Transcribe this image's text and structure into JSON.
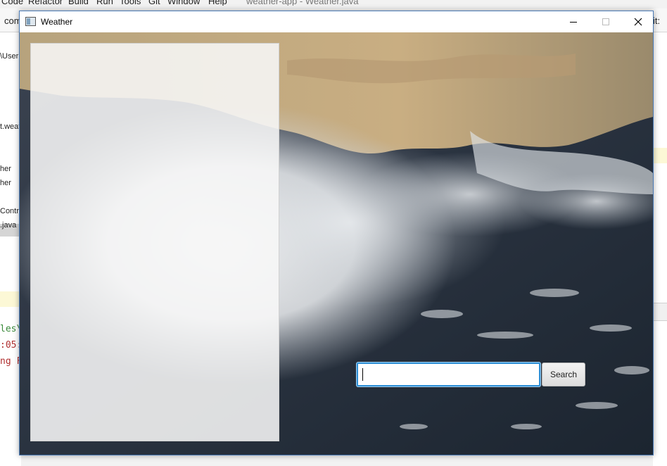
{
  "ide": {
    "menus": [
      "Code",
      "Refactor",
      "Build",
      "Run",
      "Tools",
      "Git",
      "Window",
      "Help"
    ],
    "title": "weather-app - Weather.java",
    "toolbar_left": "com",
    "toolbar_right": "it:",
    "project_rows": [
      "\\User",
      "t.weat",
      "her",
      "her",
      "Contro",
      ".java"
    ],
    "console_lines": [
      "les\\",
      ":05:",
      "ng F"
    ]
  },
  "window": {
    "title": "Weather",
    "background": "satellite-hurricane-image"
  },
  "search": {
    "value": "",
    "placeholder": "",
    "button_label": "Search"
  },
  "colors": {
    "focus_border": "#2d8fd6",
    "panel": "#f7f7f7"
  }
}
